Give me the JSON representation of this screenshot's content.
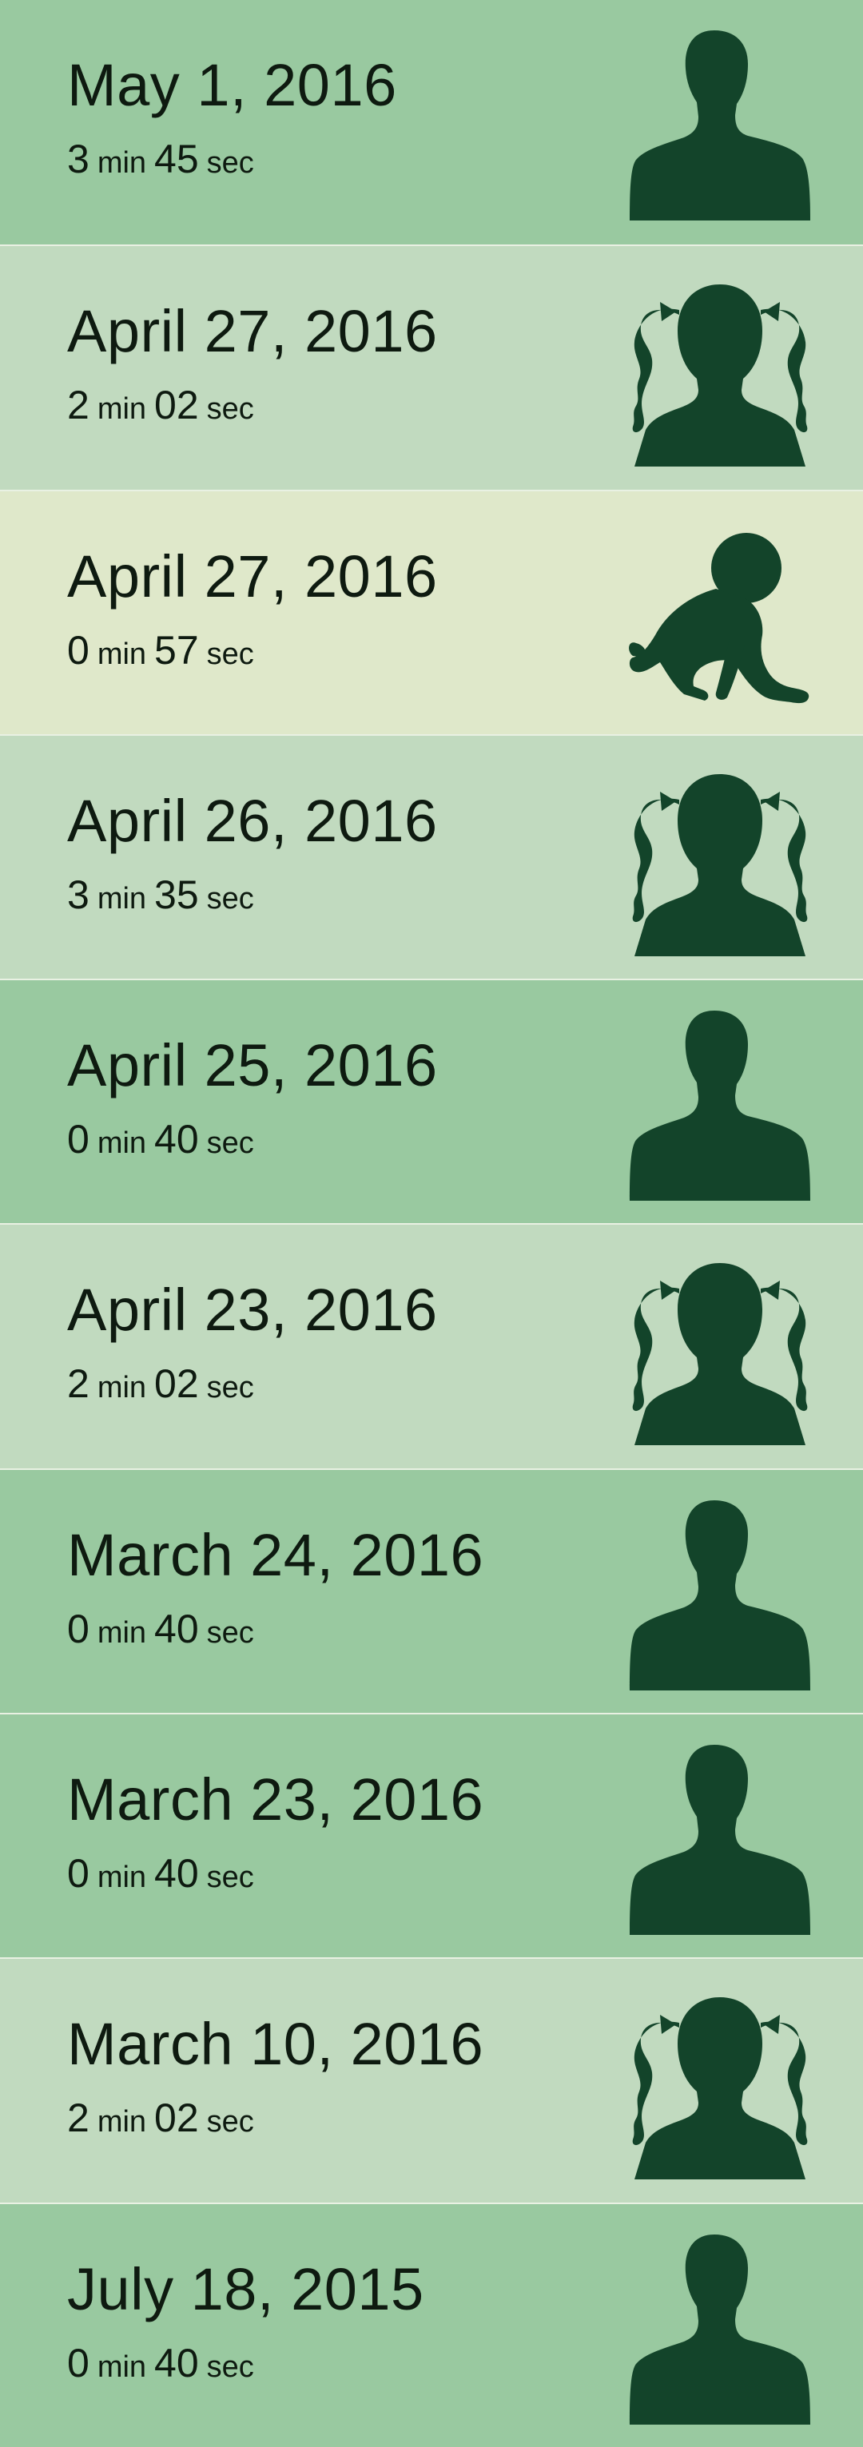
{
  "theme": {
    "adult_bg": "#99c9a0",
    "child_bg": "#c1dabf",
    "baby_bg": "#dfe8ca",
    "silhouette": "#13442a"
  },
  "sessions": [
    {
      "date": "May 1, 2016",
      "min": "3",
      "sec": "45",
      "min_unit": "min",
      "sec_unit": "sec",
      "avatar": "adult-silhouette-icon"
    },
    {
      "date": "April 27, 2016",
      "min": "2",
      "sec": "02",
      "min_unit": "min",
      "sec_unit": "sec",
      "avatar": "girl-silhouette-icon"
    },
    {
      "date": "April 27, 2016",
      "min": "0",
      "sec": "57",
      "min_unit": "min",
      "sec_unit": "sec",
      "avatar": "baby-silhouette-icon"
    },
    {
      "date": "April 26, 2016",
      "min": "3",
      "sec": "35",
      "min_unit": "min",
      "sec_unit": "sec",
      "avatar": "girl-silhouette-icon"
    },
    {
      "date": "April 25, 2016",
      "min": "0",
      "sec": "40",
      "min_unit": "min",
      "sec_unit": "sec",
      "avatar": "adult-silhouette-icon"
    },
    {
      "date": "April 23, 2016",
      "min": "2",
      "sec": "02",
      "min_unit": "min",
      "sec_unit": "sec",
      "avatar": "girl-silhouette-icon"
    },
    {
      "date": "March 24, 2016",
      "min": "0",
      "sec": "40",
      "min_unit": "min",
      "sec_unit": "sec",
      "avatar": "adult-silhouette-icon"
    },
    {
      "date": "March 23, 2016",
      "min": "0",
      "sec": "40",
      "min_unit": "min",
      "sec_unit": "sec",
      "avatar": "adult-silhouette-icon"
    },
    {
      "date": "March 10, 2016",
      "min": "2",
      "sec": "02",
      "min_unit": "min",
      "sec_unit": "sec",
      "avatar": "girl-silhouette-icon"
    },
    {
      "date": "July 18, 2015",
      "min": "0",
      "sec": "40",
      "min_unit": "min",
      "sec_unit": "sec",
      "avatar": "adult-silhouette-icon"
    }
  ]
}
